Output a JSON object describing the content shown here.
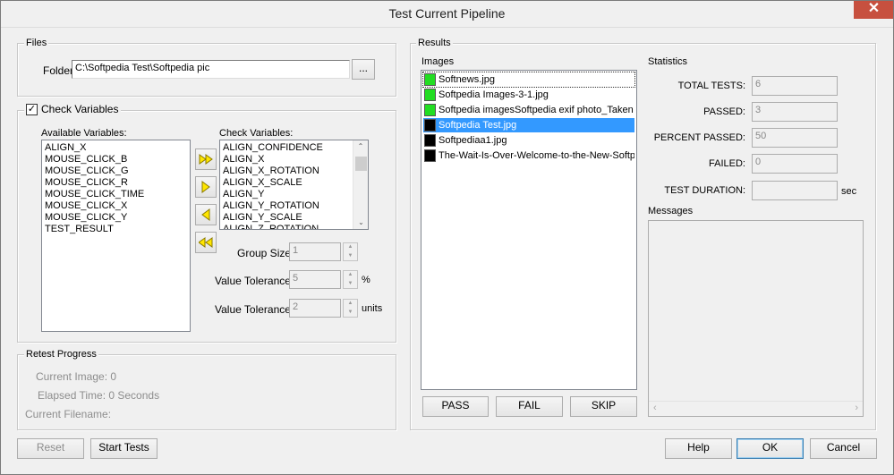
{
  "window": {
    "title": "Test Current Pipeline",
    "close_glyph": "✕"
  },
  "files": {
    "group_label": "Files",
    "folder_label": "Folder",
    "folder_value": "C:\\Softpedia Test\\Softpedia pic",
    "browse_label": "..."
  },
  "check_variables": {
    "checkbox_label": "Check Variables",
    "checked": true,
    "available_label": "Available Variables:",
    "available_items": [
      "ALIGN_X",
      "MOUSE_CLICK_B",
      "MOUSE_CLICK_G",
      "MOUSE_CLICK_R",
      "MOUSE_CLICK_TIME",
      "MOUSE_CLICK_X",
      "MOUSE_CLICK_Y",
      "TEST_RESULT"
    ],
    "check_label": "Check Variables:",
    "check_items": [
      "ALIGN_CONFIDENCE",
      "ALIGN_X",
      "ALIGN_X_ROTATION",
      "ALIGN_X_SCALE",
      "ALIGN_Y",
      "ALIGN_Y_ROTATION",
      "ALIGN_Y_SCALE",
      "ALIGN_Z_ROTATION"
    ],
    "group_size_label": "Group Size",
    "group_size_value": "1",
    "tolerance_pct_label": "Value Tolerance",
    "tolerance_pct_value": "5",
    "tolerance_pct_unit": "%",
    "tolerance_units_label": "Value Tolerance",
    "tolerance_units_value": "2",
    "tolerance_units_unit": "units"
  },
  "retest": {
    "group_label": "Retest Progress",
    "current_image": "Current Image: 0",
    "elapsed_time": "Elapsed Time: 0 Seconds",
    "current_filename": "Current Filename:"
  },
  "results": {
    "group_label": "Results",
    "images_label": "Images",
    "images": [
      {
        "name": "Softnews.jpg",
        "status_color": "#22dd22",
        "selected": false
      },
      {
        "name": "Softpedia Images-3-1.jpg",
        "status_color": "#22dd22",
        "selected": false
      },
      {
        "name": "Softpedia imagesSoftpedia exif photo_Taken b",
        "status_color": "#22dd22",
        "selected": false
      },
      {
        "name": "Softpedia Test.jpg",
        "status_color": "#000000",
        "selected": true
      },
      {
        "name": "Softpediaa1.jpg",
        "status_color": "#000000",
        "selected": false
      },
      {
        "name": "The-Wait-Is-Over-Welcome-to-the-New-Softped",
        "status_color": "#000000",
        "selected": false
      }
    ],
    "pass_label": "PASS",
    "fail_label": "FAIL",
    "skip_label": "SKIP",
    "statistics_label": "Statistics",
    "total_label": "TOTAL TESTS:",
    "total_value": "6",
    "passed_label": "PASSED:",
    "passed_value": "3",
    "percent_label": "PERCENT PASSED:",
    "percent_value": "50",
    "failed_label": "FAILED:",
    "failed_value": "0",
    "duration_label": "TEST DURATION:",
    "duration_value": "",
    "duration_unit": "sec",
    "messages_label": "Messages"
  },
  "footer": {
    "reset_label": "Reset",
    "start_label": "Start Tests",
    "help_label": "Help",
    "ok_label": "OK",
    "cancel_label": "Cancel"
  }
}
